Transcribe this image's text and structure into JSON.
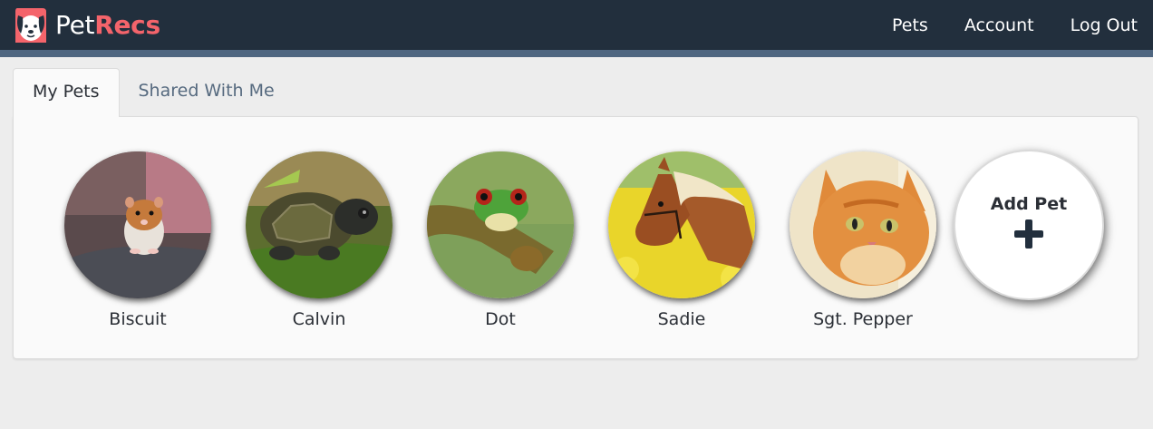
{
  "brand": {
    "name_part1": "Pet",
    "name_part2": "Recs",
    "logo_icon": "dog-face-icon",
    "accent": "#f4646b"
  },
  "nav": {
    "links": [
      {
        "label": "Pets"
      },
      {
        "label": "Account"
      },
      {
        "label": "Log Out"
      }
    ]
  },
  "tabs": [
    {
      "label": "My Pets",
      "active": true
    },
    {
      "label": "Shared With Me",
      "active": false
    }
  ],
  "pets": [
    {
      "name": "Biscuit",
      "photo": "hamster-photo"
    },
    {
      "name": "Calvin",
      "photo": "turtle-photo"
    },
    {
      "name": "Dot",
      "photo": "frog-photo"
    },
    {
      "name": "Sadie",
      "photo": "horse-photo"
    },
    {
      "name": "Sgt. Pepper",
      "photo": "cat-photo"
    }
  ],
  "add_pet": {
    "label": "Add Pet",
    "icon": "plus-icon"
  },
  "colors": {
    "navbar": "#222f3d",
    "navbar_stripe": "#4f6680",
    "page_bg": "#ededed"
  }
}
